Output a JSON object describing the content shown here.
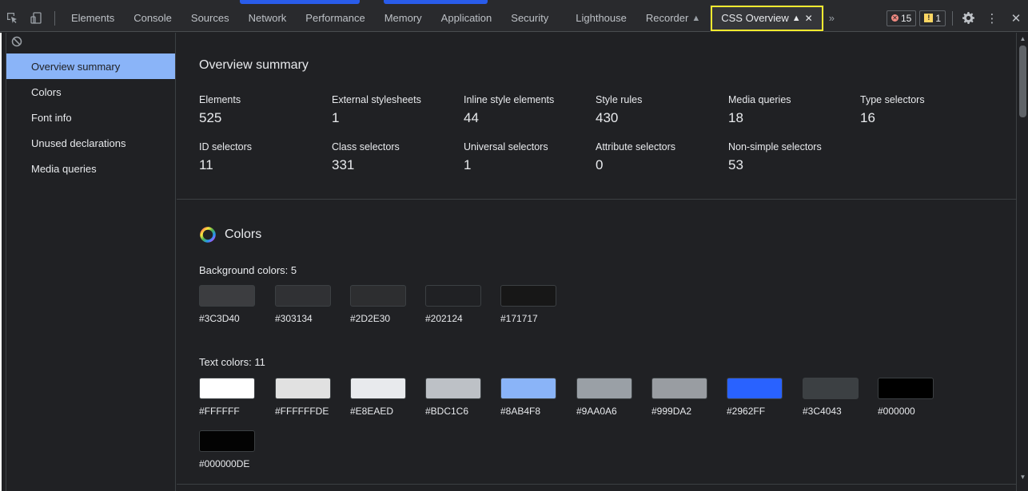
{
  "tabs": [
    {
      "label": "Elements"
    },
    {
      "label": "Console"
    },
    {
      "label": "Sources"
    },
    {
      "label": "Network"
    },
    {
      "label": "Performance"
    },
    {
      "label": "Memory"
    },
    {
      "label": "Application"
    },
    {
      "label": "Security"
    },
    {
      "label": "Lighthouse"
    },
    {
      "label": "Recorder"
    },
    {
      "label": "CSS Overview"
    }
  ],
  "more_tabs": "»",
  "badges": {
    "errors": "15",
    "warnings": "1"
  },
  "sidebar": {
    "items": [
      {
        "label": "Overview summary"
      },
      {
        "label": "Colors"
      },
      {
        "label": "Font info"
      },
      {
        "label": "Unused declarations"
      },
      {
        "label": "Media queries"
      }
    ]
  },
  "overview": {
    "title": "Overview summary",
    "stats": [
      {
        "label": "Elements",
        "value": "525"
      },
      {
        "label": "External stylesheets",
        "value": "1"
      },
      {
        "label": "Inline style elements",
        "value": "44"
      },
      {
        "label": "Style rules",
        "value": "430"
      },
      {
        "label": "Media queries",
        "value": "18"
      },
      {
        "label": "Type selectors",
        "value": "16"
      },
      {
        "label": "ID selectors",
        "value": "11"
      },
      {
        "label": "Class selectors",
        "value": "331"
      },
      {
        "label": "Universal selectors",
        "value": "1"
      },
      {
        "label": "Attribute selectors",
        "value": "0"
      },
      {
        "label": "Non-simple selectors",
        "value": "53"
      }
    ]
  },
  "colors": {
    "title": "Colors",
    "background_title": "Background colors: 5",
    "background": [
      {
        "hex": "#3C3D40",
        "color": "#3c3d40"
      },
      {
        "hex": "#303134",
        "color": "#303134"
      },
      {
        "hex": "#2D2E30",
        "color": "#2d2e30"
      },
      {
        "hex": "#202124",
        "color": "#202124"
      },
      {
        "hex": "#171717",
        "color": "#171717"
      }
    ],
    "text_title": "Text colors: 11",
    "text": [
      {
        "hex": "#FFFFFF",
        "color": "#ffffff"
      },
      {
        "hex": "#FFFFFFDE",
        "color": "#ffffffde"
      },
      {
        "hex": "#E8EAED",
        "color": "#e8eaed"
      },
      {
        "hex": "#BDC1C6",
        "color": "#bdc1c6"
      },
      {
        "hex": "#8AB4F8",
        "color": "#8ab4f8"
      },
      {
        "hex": "#9AA0A6",
        "color": "#9aa0a6"
      },
      {
        "hex": "#999DA2",
        "color": "#999da2"
      },
      {
        "hex": "#2962FF",
        "color": "#2962ff"
      },
      {
        "hex": "#3C4043",
        "color": "#3c4043"
      },
      {
        "hex": "#000000",
        "color": "#000000"
      },
      {
        "hex": "#000000DE",
        "color": "#000000de"
      }
    ]
  },
  "theme": {
    "accent": "#8ab4f8",
    "highlight": "#f7ea2f",
    "background": "#202124"
  }
}
